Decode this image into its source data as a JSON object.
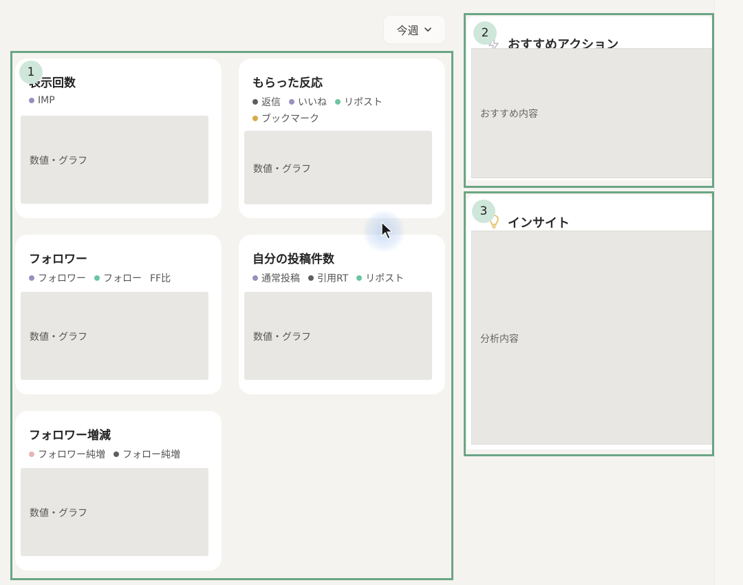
{
  "period_select": {
    "label": "今週",
    "icon": "chevron-down-icon"
  },
  "badges": [
    "1",
    "2",
    "3"
  ],
  "cards": [
    {
      "title": "表示回数",
      "legend": [
        {
          "label": "IMP",
          "color": "#9b8fc0"
        }
      ],
      "placeholder": "数値・グラフ"
    },
    {
      "title": "もらった反応",
      "legend": [
        {
          "label": "返信",
          "color": "#5e5e5e"
        },
        {
          "label": "いいね",
          "color": "#9b8fc0"
        },
        {
          "label": "リポスト",
          "color": "#6cc4a0"
        },
        {
          "label": "ブックマーク",
          "color": "#d8aa48"
        }
      ],
      "placeholder": "数値・グラフ"
    },
    {
      "title": "フォロワー",
      "legend": [
        {
          "label": "フォロワー",
          "color": "#9b8fc0"
        },
        {
          "label": "フォロー",
          "color": "#6cc4a0"
        },
        {
          "label": "FF比",
          "color": ""
        }
      ],
      "placeholder": "数値・グラフ"
    },
    {
      "title": "自分の投稿件数",
      "legend": [
        {
          "label": "通常投稿",
          "color": "#9b8fc0"
        },
        {
          "label": "引用RT",
          "color": "#5e5e5e"
        },
        {
          "label": "リポスト",
          "color": "#6cc4a0"
        }
      ],
      "placeholder": "数値・グラフ"
    },
    {
      "title": "フォロワー増減",
      "legend": [
        {
          "label": "フォロワー純増",
          "color": "#e8b4b8"
        },
        {
          "label": "フォロー純増",
          "color": "#5e5e5e"
        }
      ],
      "placeholder": "数値・グラフ"
    }
  ],
  "recommend": {
    "title": "おすすめアクション",
    "icon": "lightning-icon",
    "content": "おすすめ内容"
  },
  "insight": {
    "title": "インサイト",
    "icon": "lightbulb-icon",
    "content": "分析内容"
  },
  "colors": {
    "frame": "#6aa585",
    "badge": "#cfe7da",
    "background": "#f4f3ef"
  }
}
